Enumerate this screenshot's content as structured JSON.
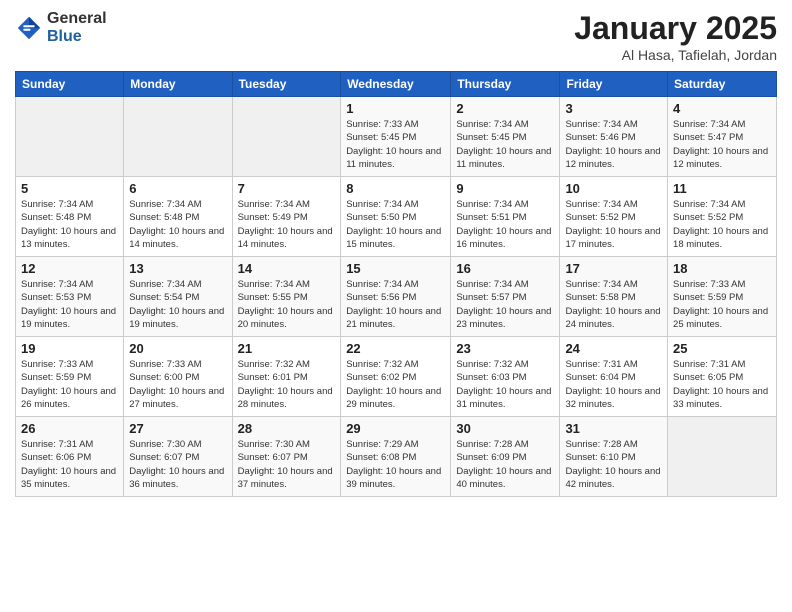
{
  "header": {
    "logo_general": "General",
    "logo_blue": "Blue",
    "month_title": "January 2025",
    "location": "Al Hasa, Tafielah, Jordan"
  },
  "weekdays": [
    "Sunday",
    "Monday",
    "Tuesday",
    "Wednesday",
    "Thursday",
    "Friday",
    "Saturday"
  ],
  "weeks": [
    [
      {
        "day": "",
        "sunrise": "",
        "sunset": "",
        "daylight": ""
      },
      {
        "day": "",
        "sunrise": "",
        "sunset": "",
        "daylight": ""
      },
      {
        "day": "",
        "sunrise": "",
        "sunset": "",
        "daylight": ""
      },
      {
        "day": "1",
        "sunrise": "Sunrise: 7:33 AM",
        "sunset": "Sunset: 5:45 PM",
        "daylight": "Daylight: 10 hours and 11 minutes."
      },
      {
        "day": "2",
        "sunrise": "Sunrise: 7:34 AM",
        "sunset": "Sunset: 5:45 PM",
        "daylight": "Daylight: 10 hours and 11 minutes."
      },
      {
        "day": "3",
        "sunrise": "Sunrise: 7:34 AM",
        "sunset": "Sunset: 5:46 PM",
        "daylight": "Daylight: 10 hours and 12 minutes."
      },
      {
        "day": "4",
        "sunrise": "Sunrise: 7:34 AM",
        "sunset": "Sunset: 5:47 PM",
        "daylight": "Daylight: 10 hours and 12 minutes."
      }
    ],
    [
      {
        "day": "5",
        "sunrise": "Sunrise: 7:34 AM",
        "sunset": "Sunset: 5:48 PM",
        "daylight": "Daylight: 10 hours and 13 minutes."
      },
      {
        "day": "6",
        "sunrise": "Sunrise: 7:34 AM",
        "sunset": "Sunset: 5:48 PM",
        "daylight": "Daylight: 10 hours and 14 minutes."
      },
      {
        "day": "7",
        "sunrise": "Sunrise: 7:34 AM",
        "sunset": "Sunset: 5:49 PM",
        "daylight": "Daylight: 10 hours and 14 minutes."
      },
      {
        "day": "8",
        "sunrise": "Sunrise: 7:34 AM",
        "sunset": "Sunset: 5:50 PM",
        "daylight": "Daylight: 10 hours and 15 minutes."
      },
      {
        "day": "9",
        "sunrise": "Sunrise: 7:34 AM",
        "sunset": "Sunset: 5:51 PM",
        "daylight": "Daylight: 10 hours and 16 minutes."
      },
      {
        "day": "10",
        "sunrise": "Sunrise: 7:34 AM",
        "sunset": "Sunset: 5:52 PM",
        "daylight": "Daylight: 10 hours and 17 minutes."
      },
      {
        "day": "11",
        "sunrise": "Sunrise: 7:34 AM",
        "sunset": "Sunset: 5:52 PM",
        "daylight": "Daylight: 10 hours and 18 minutes."
      }
    ],
    [
      {
        "day": "12",
        "sunrise": "Sunrise: 7:34 AM",
        "sunset": "Sunset: 5:53 PM",
        "daylight": "Daylight: 10 hours and 19 minutes."
      },
      {
        "day": "13",
        "sunrise": "Sunrise: 7:34 AM",
        "sunset": "Sunset: 5:54 PM",
        "daylight": "Daylight: 10 hours and 19 minutes."
      },
      {
        "day": "14",
        "sunrise": "Sunrise: 7:34 AM",
        "sunset": "Sunset: 5:55 PM",
        "daylight": "Daylight: 10 hours and 20 minutes."
      },
      {
        "day": "15",
        "sunrise": "Sunrise: 7:34 AM",
        "sunset": "Sunset: 5:56 PM",
        "daylight": "Daylight: 10 hours and 21 minutes."
      },
      {
        "day": "16",
        "sunrise": "Sunrise: 7:34 AM",
        "sunset": "Sunset: 5:57 PM",
        "daylight": "Daylight: 10 hours and 23 minutes."
      },
      {
        "day": "17",
        "sunrise": "Sunrise: 7:34 AM",
        "sunset": "Sunset: 5:58 PM",
        "daylight": "Daylight: 10 hours and 24 minutes."
      },
      {
        "day": "18",
        "sunrise": "Sunrise: 7:33 AM",
        "sunset": "Sunset: 5:59 PM",
        "daylight": "Daylight: 10 hours and 25 minutes."
      }
    ],
    [
      {
        "day": "19",
        "sunrise": "Sunrise: 7:33 AM",
        "sunset": "Sunset: 5:59 PM",
        "daylight": "Daylight: 10 hours and 26 minutes."
      },
      {
        "day": "20",
        "sunrise": "Sunrise: 7:33 AM",
        "sunset": "Sunset: 6:00 PM",
        "daylight": "Daylight: 10 hours and 27 minutes."
      },
      {
        "day": "21",
        "sunrise": "Sunrise: 7:32 AM",
        "sunset": "Sunset: 6:01 PM",
        "daylight": "Daylight: 10 hours and 28 minutes."
      },
      {
        "day": "22",
        "sunrise": "Sunrise: 7:32 AM",
        "sunset": "Sunset: 6:02 PM",
        "daylight": "Daylight: 10 hours and 29 minutes."
      },
      {
        "day": "23",
        "sunrise": "Sunrise: 7:32 AM",
        "sunset": "Sunset: 6:03 PM",
        "daylight": "Daylight: 10 hours and 31 minutes."
      },
      {
        "day": "24",
        "sunrise": "Sunrise: 7:31 AM",
        "sunset": "Sunset: 6:04 PM",
        "daylight": "Daylight: 10 hours and 32 minutes."
      },
      {
        "day": "25",
        "sunrise": "Sunrise: 7:31 AM",
        "sunset": "Sunset: 6:05 PM",
        "daylight": "Daylight: 10 hours and 33 minutes."
      }
    ],
    [
      {
        "day": "26",
        "sunrise": "Sunrise: 7:31 AM",
        "sunset": "Sunset: 6:06 PM",
        "daylight": "Daylight: 10 hours and 35 minutes."
      },
      {
        "day": "27",
        "sunrise": "Sunrise: 7:30 AM",
        "sunset": "Sunset: 6:07 PM",
        "daylight": "Daylight: 10 hours and 36 minutes."
      },
      {
        "day": "28",
        "sunrise": "Sunrise: 7:30 AM",
        "sunset": "Sunset: 6:07 PM",
        "daylight": "Daylight: 10 hours and 37 minutes."
      },
      {
        "day": "29",
        "sunrise": "Sunrise: 7:29 AM",
        "sunset": "Sunset: 6:08 PM",
        "daylight": "Daylight: 10 hours and 39 minutes."
      },
      {
        "day": "30",
        "sunrise": "Sunrise: 7:28 AM",
        "sunset": "Sunset: 6:09 PM",
        "daylight": "Daylight: 10 hours and 40 minutes."
      },
      {
        "day": "31",
        "sunrise": "Sunrise: 7:28 AM",
        "sunset": "Sunset: 6:10 PM",
        "daylight": "Daylight: 10 hours and 42 minutes."
      },
      {
        "day": "",
        "sunrise": "",
        "sunset": "",
        "daylight": ""
      }
    ]
  ]
}
